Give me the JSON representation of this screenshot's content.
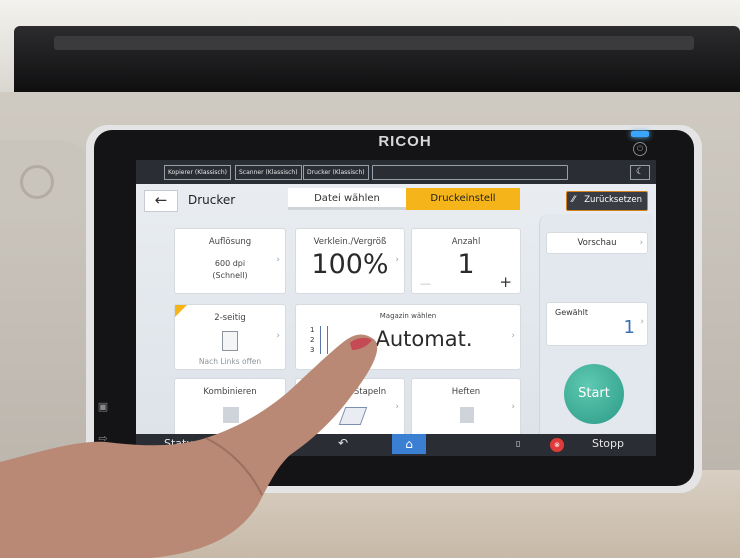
{
  "device": {
    "brand": "RICOH"
  },
  "top_bar": {
    "app_tabs": [
      "Kopierer (Klassisch)",
      "Scanner (Klassisch)",
      "Drucker (Klassisch)"
    ]
  },
  "header": {
    "back_symbol": "←",
    "title": "Drucker",
    "tabs": [
      {
        "label": "Datei wählen",
        "active": false
      },
      {
        "label": "Druckeinstell",
        "active": true
      }
    ],
    "reset_label": "Zurücksetzen"
  },
  "tiles": {
    "resolution": {
      "label": "Auflösung",
      "value_line1": "600 dpi",
      "value_line2": "(Schnell)"
    },
    "zoom": {
      "label": "Verklein./Vergröß",
      "value": "100%"
    },
    "copies": {
      "label": "Anzahl",
      "value": "1",
      "minus": "—",
      "plus": "+"
    },
    "duplex": {
      "label": "2-seitig",
      "sublabel": "Nach Links offen"
    },
    "tray": {
      "label": "Magazin wählen",
      "value": "Automat.",
      "tray_numbers": [
        "1",
        "2",
        "3"
      ]
    },
    "combine": {
      "label": "Kombinieren"
    },
    "stack": {
      "label": "Stapeln"
    },
    "staple": {
      "label": "Heften"
    }
  },
  "side_panel": {
    "preview_label": "Vorschau",
    "selected_label": "Gewählt",
    "selected_value": "1",
    "start_label": "Start"
  },
  "bottom_bar": {
    "status_label": "Status n",
    "stop_label": "Stopp"
  },
  "colors": {
    "accent_tab": "#f4b41a",
    "reset_border": "#d4821c",
    "start_button": "#2a9a86",
    "home_button": "#3b7fd3",
    "stop_icon": "#e03b3b",
    "bar_background": "#2b2d35"
  }
}
